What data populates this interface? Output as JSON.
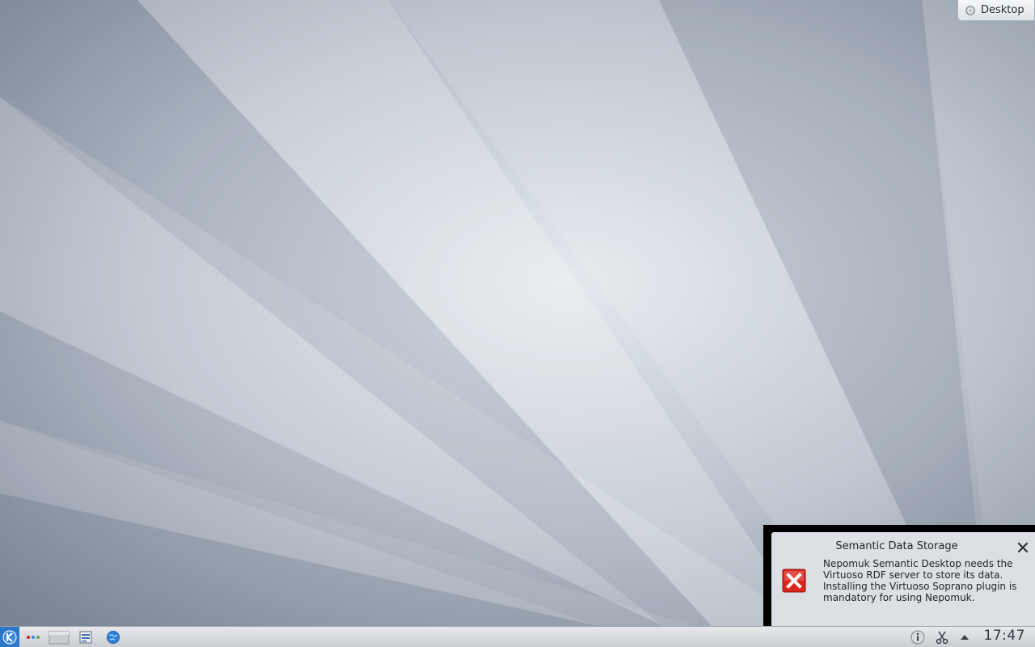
{
  "desktop": {
    "toolbox_label": "Desktop"
  },
  "notification": {
    "title": "Semantic Data Storage",
    "message": "Nepomuk Semantic Desktop needs the Virtuoso RDF server to store its data. Installing the Virtuoso Soprano plugin is mandatory for using Nepomuk.",
    "icon": "error-icon"
  },
  "taskbar": {
    "launchers": [
      "kickoff-icon",
      "activity-switcher-icon",
      "show-desktop-icon",
      "task-manager-icon",
      "network-globe-icon"
    ],
    "tray": [
      "information-icon",
      "klipper-scissors-icon",
      "show-hidden-arrow-icon"
    ],
    "clock": "17:47"
  },
  "colors": {
    "wallpaper_base": "#8f9aa8",
    "wallpaper_light": "#dde3ea",
    "taskbar_top": "#e7e9ec",
    "taskbar_bottom": "#c9cdd2",
    "kickoff_blue": "#2a78c6",
    "error_red": "#d9261c"
  }
}
